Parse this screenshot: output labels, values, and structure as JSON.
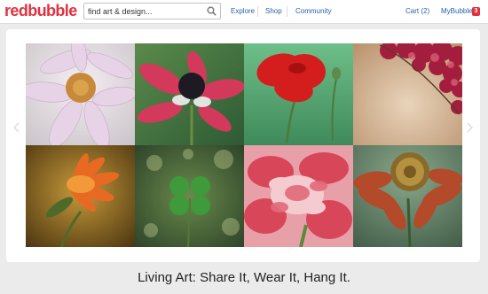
{
  "brand": {
    "logo_text": "redbubble",
    "logo_part1": "red",
    "logo_part2": "bubble",
    "brand_color": "#e4303f"
  },
  "search": {
    "placeholder": "find art & design..."
  },
  "nav": {
    "explore": "Explore",
    "shop": "Shop",
    "community": "Community",
    "cart": "Cart (2)",
    "mybubble": "MyBubble",
    "mybubble_badge": "3",
    "link_color": "#2a5fa8"
  },
  "gallery": {
    "prev_icon": "chevron-left-icon",
    "next_icon": "chevron-right-icon",
    "tiles": [
      "white-dahlia-photo",
      "pink-anemone-photo",
      "red-poppy-photo",
      "pink-blossom-branch-photo",
      "orange-dahlia-photo",
      "four-leaf-clover-photo",
      "pink-carnation-photo",
      "helenium-flower-photo"
    ]
  },
  "tagline": "Living Art: Share It, Wear It, Hang It."
}
